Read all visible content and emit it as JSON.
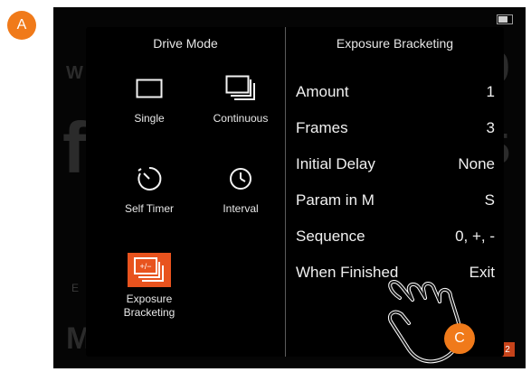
{
  "badges": {
    "a": "A",
    "c": "C"
  },
  "drive_mode": {
    "title": "Drive Mode",
    "modes": [
      {
        "label": "Single",
        "icon": "single-frame-icon",
        "selected": false
      },
      {
        "label": "Continuous",
        "icon": "continuous-frames-icon",
        "selected": false
      },
      {
        "label": "Self Timer",
        "icon": "self-timer-icon",
        "selected": false
      },
      {
        "label": "Interval",
        "icon": "interval-clock-icon",
        "selected": false
      },
      {
        "label": "Exposure Bracketing",
        "icon": "exposure-bracketing-icon",
        "selected": true
      }
    ]
  },
  "exposure_bracketing": {
    "title": "Exposure Bracketing",
    "rows": [
      {
        "label": "Amount",
        "value": "1"
      },
      {
        "label": "Frames",
        "value": "3"
      },
      {
        "label": "Initial Delay",
        "value": "None"
      },
      {
        "label": "Param in M",
        "value": "S"
      },
      {
        "label": "Sequence",
        "value": "0, +, -"
      },
      {
        "label": "When Finished",
        "value": "Exit"
      }
    ]
  },
  "background": {
    "corner_count": "2"
  },
  "colors": {
    "accent": "#e8531e",
    "badge": "#f07a1a",
    "panel": "#000000"
  }
}
